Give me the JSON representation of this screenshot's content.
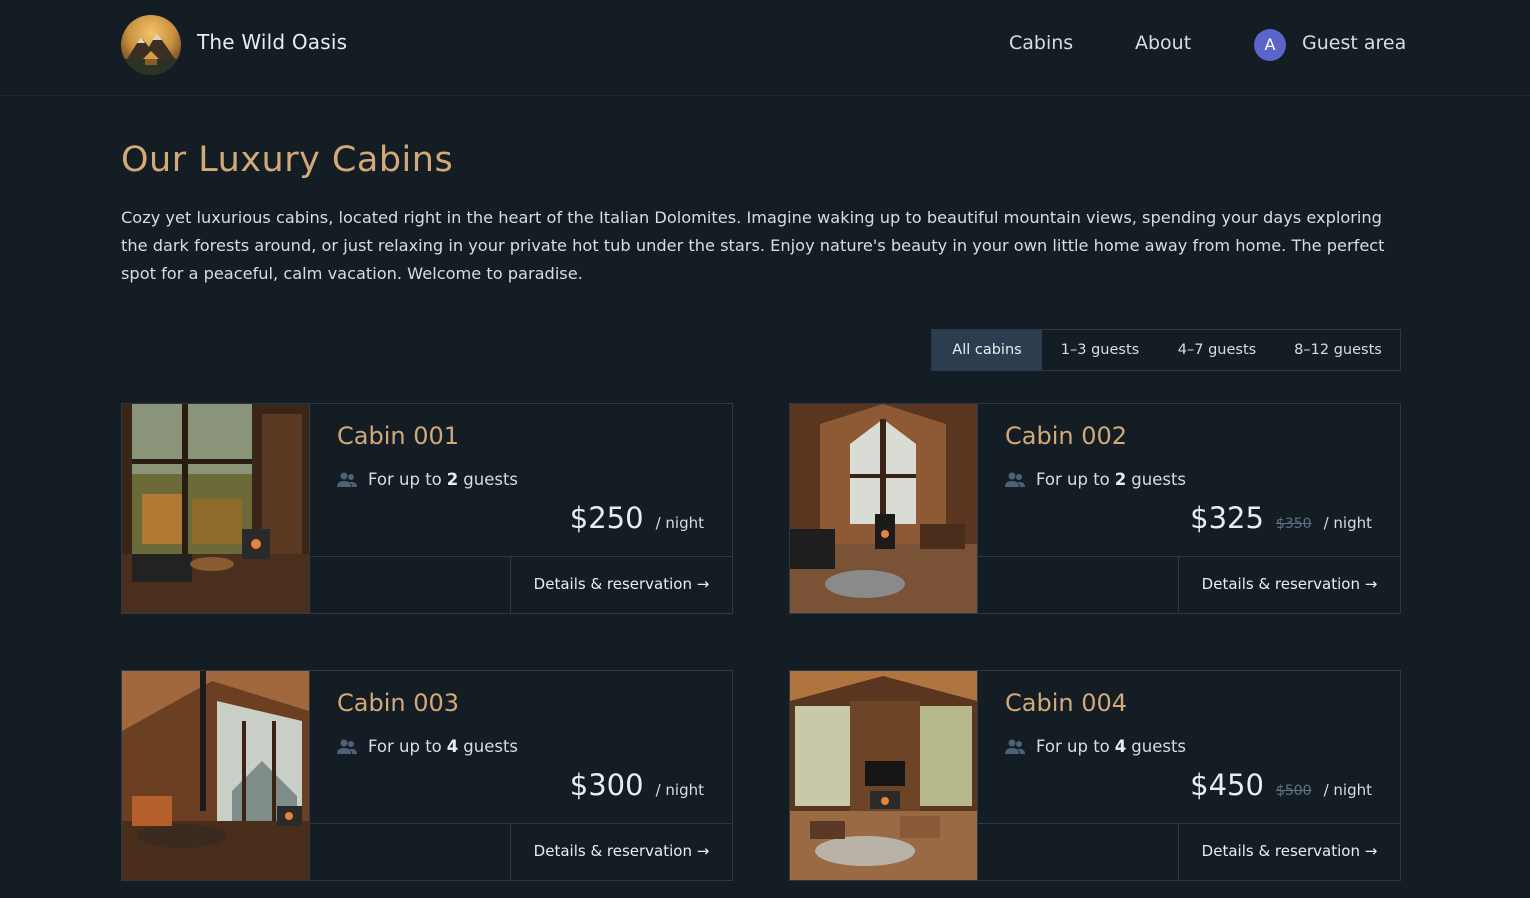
{
  "header": {
    "brand": "The Wild Oasis",
    "nav": [
      "Cabins",
      "About"
    ],
    "avatar_initial": "A",
    "guest_area": "Guest area",
    "logo_icon": "mountain-cabin-logo"
  },
  "page": {
    "title": "Our Luxury Cabins",
    "intro": "Cozy yet luxurious cabins, located right in the heart of the Italian Dolomites. Imagine waking up to beautiful mountain views, spending your days exploring the dark forests around, or just relaxing in your private hot tub under the stars. Enjoy nature's beauty in your own little home away from home. The perfect spot for a peaceful, calm vacation. Welcome to paradise."
  },
  "filter": {
    "options": [
      "All cabins",
      "1–3 guests",
      "4–7 guests",
      "8–12 guests"
    ],
    "active": "All cabins"
  },
  "cabins": [
    {
      "name": "Cabin 001",
      "guests_prefix": "For up to",
      "guests": "2",
      "guests_suffix": "guests",
      "price": "$250",
      "old_price": "",
      "per": "/ night",
      "cta": "Details & reservation →"
    },
    {
      "name": "Cabin 002",
      "guests_prefix": "For up to",
      "guests": "2",
      "guests_suffix": "guests",
      "price": "$325",
      "old_price": "$350",
      "per": "/ night",
      "cta": "Details & reservation →"
    },
    {
      "name": "Cabin 003",
      "guests_prefix": "For up to",
      "guests": "4",
      "guests_suffix": "guests",
      "price": "$300",
      "old_price": "",
      "per": "/ night",
      "cta": "Details & reservation →"
    },
    {
      "name": "Cabin 004",
      "guests_prefix": "For up to",
      "guests": "4",
      "guests_suffix": "guests",
      "price": "$450",
      "old_price": "$500",
      "per": "/ night",
      "cta": "Details & reservation →"
    }
  ],
  "colors": {
    "background": "#141c24",
    "accent": "#d2a978",
    "border": "#2c3a47",
    "avatar": "#5b64c9",
    "active_filter": "#2c3d50"
  }
}
